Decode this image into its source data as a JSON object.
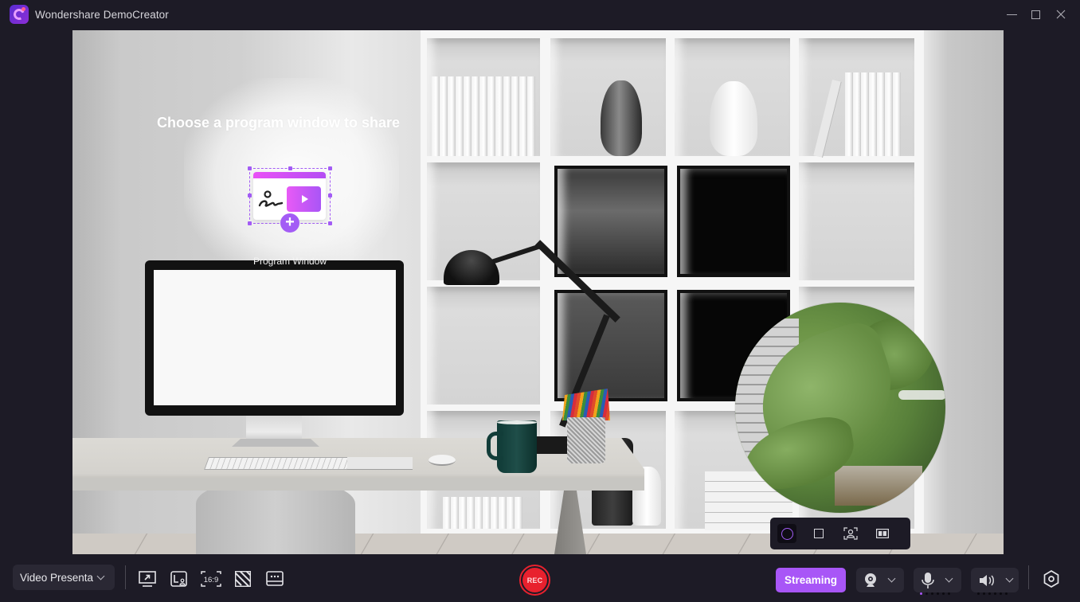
{
  "window": {
    "title": "Wondershare DemoCreator",
    "controls": [
      "minimize",
      "maximize",
      "close"
    ]
  },
  "stage": {
    "choose_title": "Choose a program window to share",
    "program_window_label": "Program Window",
    "webcam_shapes": [
      {
        "name": "circle",
        "active": true
      },
      {
        "name": "square",
        "active": false
      },
      {
        "name": "portrait-focus",
        "active": false
      },
      {
        "name": "split-layout",
        "active": false
      }
    ]
  },
  "bottombar": {
    "mode_select": {
      "value": "Video Presenta"
    },
    "tools": [
      {
        "name": "screen-share",
        "icon": "monitor-arrow-icon"
      },
      {
        "name": "webcam-overlay",
        "icon": "window-person-icon"
      },
      {
        "name": "aspect-ratio",
        "icon": "aspect-ratio-icon",
        "label": "16:9"
      },
      {
        "name": "background",
        "icon": "stripes-icon"
      },
      {
        "name": "more-tools",
        "icon": "more-panel-icon"
      }
    ],
    "rec_label": "REC",
    "streaming_label": "Streaming",
    "devices": [
      {
        "name": "camera",
        "icon": "webcam-icon"
      },
      {
        "name": "microphone",
        "icon": "microphone-icon",
        "level_active_dots": 1,
        "level_total_dots": 6
      },
      {
        "name": "speaker",
        "icon": "speaker-icon",
        "level_active_dots": 0,
        "level_total_dots": 6
      }
    ],
    "settings_icon": "settings-hex-icon"
  },
  "colors": {
    "accent": "#a856f7",
    "rec": "#e8212e",
    "background": "#1d1b26",
    "control_bg": "#2a2834"
  }
}
